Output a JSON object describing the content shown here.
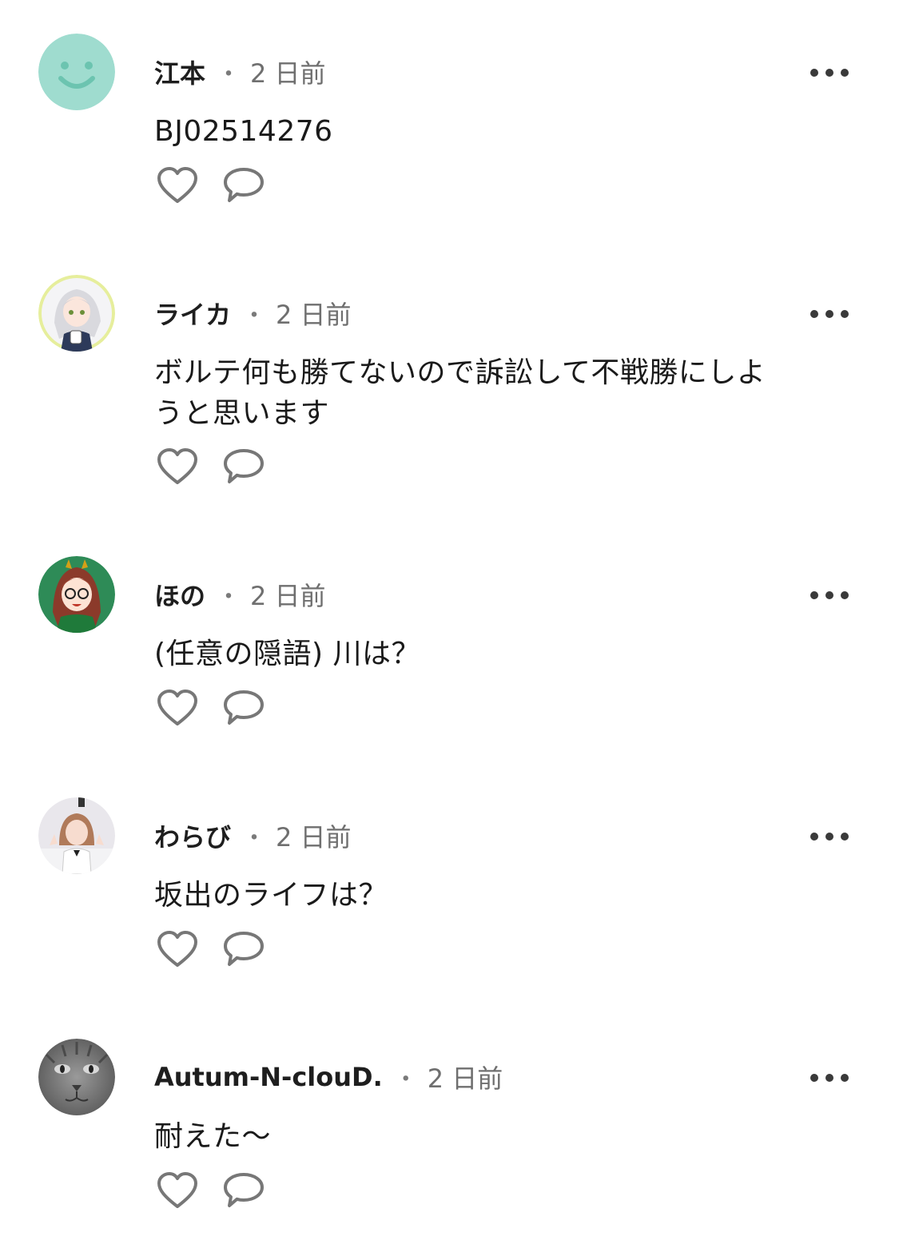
{
  "comments": [
    {
      "user": "江本",
      "separator": "・",
      "time": "2 日前",
      "text": "BJ02514276",
      "avatar_icon": "smiley-face-icon",
      "avatar_color": "#9fdccf"
    },
    {
      "user": "ライカ",
      "separator": "・",
      "time": "2 日前",
      "text": "ボルテ何も勝てないので訴訟して不戦勝にしようと思います",
      "avatar_icon": "anime-girl-avatar",
      "avatar_color": "#e6ee9c"
    },
    {
      "user": "ほの",
      "separator": "・",
      "time": "2 日前",
      "text": "(任意の隠語) 川は？",
      "avatar_icon": "anime-girl-green-avatar",
      "avatar_color": "#2e8b57"
    },
    {
      "user": "わらび",
      "separator": "・",
      "time": "2 日前",
      "text": "坂出のライフは？",
      "avatar_icon": "photo-person-avatar",
      "avatar_color": "#e9e7ec"
    },
    {
      "user": "Autum-N-clouD.",
      "separator": "・",
      "time": "2 日前",
      "text": "耐えた〜",
      "avatar_icon": "cat-photo-avatar",
      "avatar_color": "#8a8a8a"
    }
  ],
  "icons": {
    "like": "heart-outline-icon",
    "reply": "speech-bubble-icon",
    "more": "more-options-icon"
  }
}
